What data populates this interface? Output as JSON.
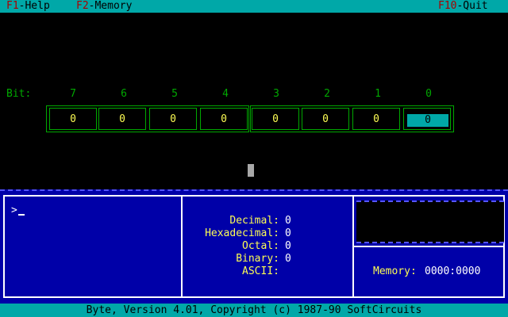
{
  "menu": {
    "help": {
      "key": "F1",
      "label": "-Help"
    },
    "memory": {
      "key": "F2",
      "label": "-Memory"
    },
    "quit": {
      "key": "F10",
      "label": "-Quit"
    }
  },
  "bits": {
    "row_label": "Bit:",
    "numbers": [
      "7",
      "6",
      "5",
      "4",
      "3",
      "2",
      "1",
      "0"
    ],
    "values": [
      "0",
      "0",
      "0",
      "0",
      "0",
      "0",
      "0",
      "0"
    ],
    "selected_index": 7
  },
  "console": {
    "prompt": ">"
  },
  "conversions": {
    "decimal": {
      "label": "Decimal:",
      "value": "0"
    },
    "hexadecimal": {
      "label": "Hexadecimal:",
      "value": "0"
    },
    "octal": {
      "label": "Octal:",
      "value": "0"
    },
    "binary": {
      "label": "Binary:",
      "value": "0"
    },
    "ascii": {
      "label": "ASCII:",
      "value": ""
    }
  },
  "memory": {
    "label": "Memory:",
    "value": "0000:0000"
  },
  "status": "Byte, Version 4.01, Copyright (c) 1987-90 SoftCircuits",
  "colors": {
    "menu_bg": "#00A8A8",
    "hotkey": "#A80000",
    "bit_text": "#FCFC54",
    "bit_border": "#00A800",
    "panel_bg": "#0000A8"
  }
}
